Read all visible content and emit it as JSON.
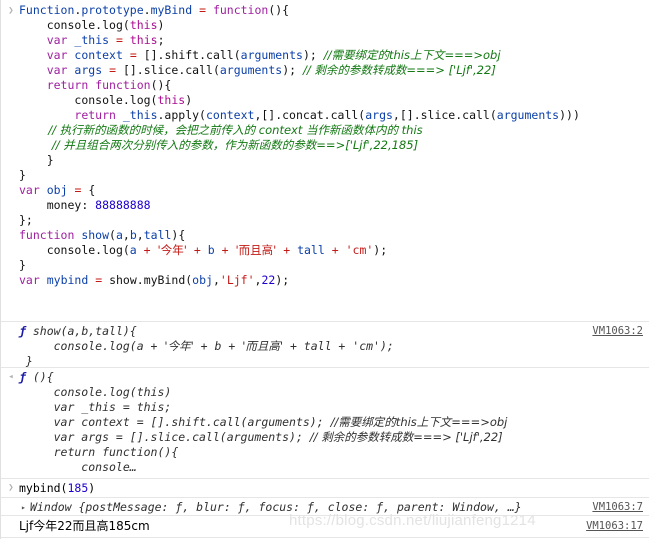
{
  "console": {
    "prompt_glyph": "❯",
    "expander_glyph": "▸",
    "collapsed_glyph": "◂",
    "watermark": "https://blog.csdn.net/liujianfeng1214",
    "input_block": {
      "prompt": "❯",
      "lines": [
        "Function.prototype.myBind = function(){",
        "    console.log(this)",
        "    var _this = this;",
        "    var context = [].shift.call(arguments); //需要绑定的this上下文===>obj",
        "    var args = [].slice.call(arguments); // 剩余的参数转成数===> ['Ljf',22]",
        "    return function(){",
        "        console.log(this)",
        "        return _this.apply(context,[].concat.call(args,[].slice.call(arguments)))",
        "        // 执行新的函数的时候，会把之前传入的 context 当作新函数体内的 this",
        "         // 并且组合两次分别传入的参数，作为新函数的参数==>['Ljf',22,185]",
        "    }",
        "}",
        "var obj = {",
        "    money: 88888888",
        "};",
        "function show(a,b,tall){",
        "    console.log(a + '今年' + b + '而且高' + tall + 'cm');",
        "}",
        "var mybind = show.myBind(obj,'Ljf',22);"
      ]
    },
    "output_blocks": [
      {
        "id": "show-fn",
        "source_link": "VM1063:2",
        "expander": null,
        "lines": [
          "ƒ show(a,b,tall){",
          "     console.log(a + '今年' + b + '而且高' + tall + 'cm');",
          " }"
        ]
      },
      {
        "id": "bound-fn",
        "source_link": "",
        "expander": "◂",
        "lines": [
          "ƒ (){",
          "     console.log(this)",
          "     var _this = this;",
          "     var context = [].shift.call(arguments); //需要绑定的this上下文===>obj",
          "     var args = [].slice.call(arguments); // 剩余的参数转成数===> ['Ljf',22]",
          "     return function(){",
          "         console…"
        ]
      }
    ],
    "command_line": {
      "prompt": "❯",
      "text_before": "mybind(",
      "number": "185",
      "text_after": ")"
    },
    "window_row": {
      "expander": "▸",
      "text": "Window {postMessage: ƒ, blur: ƒ, focus: ƒ, close: ƒ, parent: Window, …}",
      "source_link": "VM1063:7"
    },
    "final_result": {
      "text": "Ljf今年22而且高185cm",
      "source_link": "VM1063:17"
    },
    "colors": {
      "keyword": "#a020a0",
      "string": "#c41a16",
      "number": "#1c00cf",
      "comment": "#127812",
      "identifier": "#0b3fa8",
      "link": "#555555",
      "watermark": "#e3e3e3"
    }
  }
}
